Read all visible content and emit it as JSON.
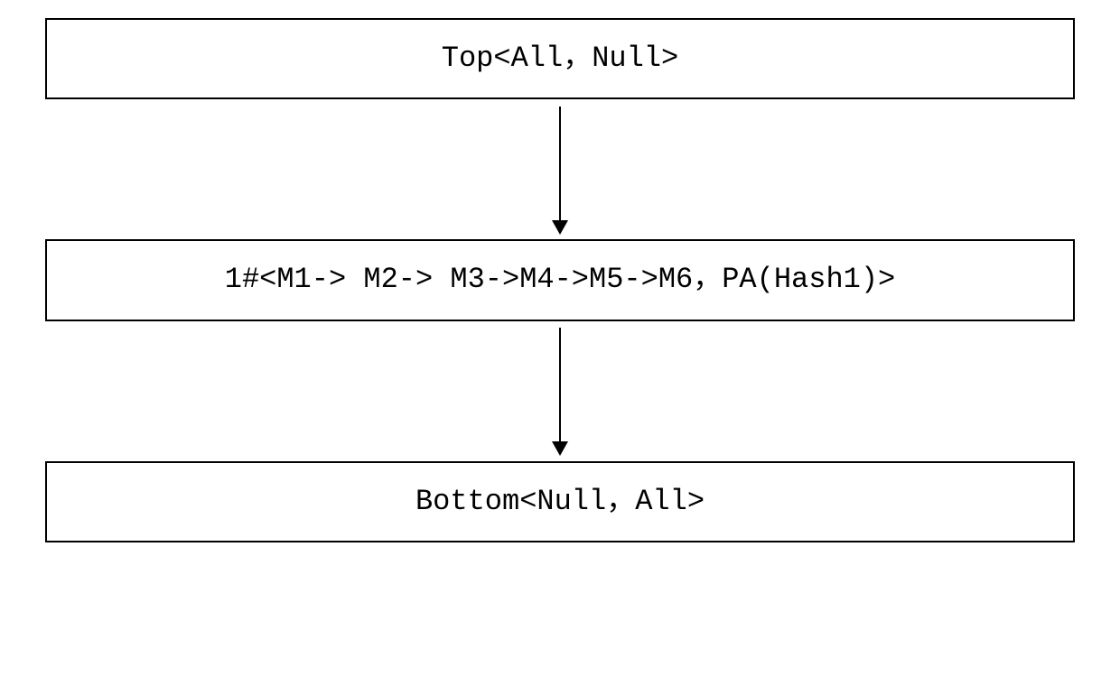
{
  "diagram": {
    "nodes": [
      {
        "id": "top",
        "label": "Top<All，Null>"
      },
      {
        "id": "middle",
        "label": "1#<M1-> M2-> M3->M4->M5->M6，PA(Hash1)>"
      },
      {
        "id": "bottom",
        "label": "Bottom<Null，All>"
      }
    ],
    "edges": [
      {
        "from": "top",
        "to": "middle"
      },
      {
        "from": "middle",
        "to": "bottom"
      }
    ]
  }
}
